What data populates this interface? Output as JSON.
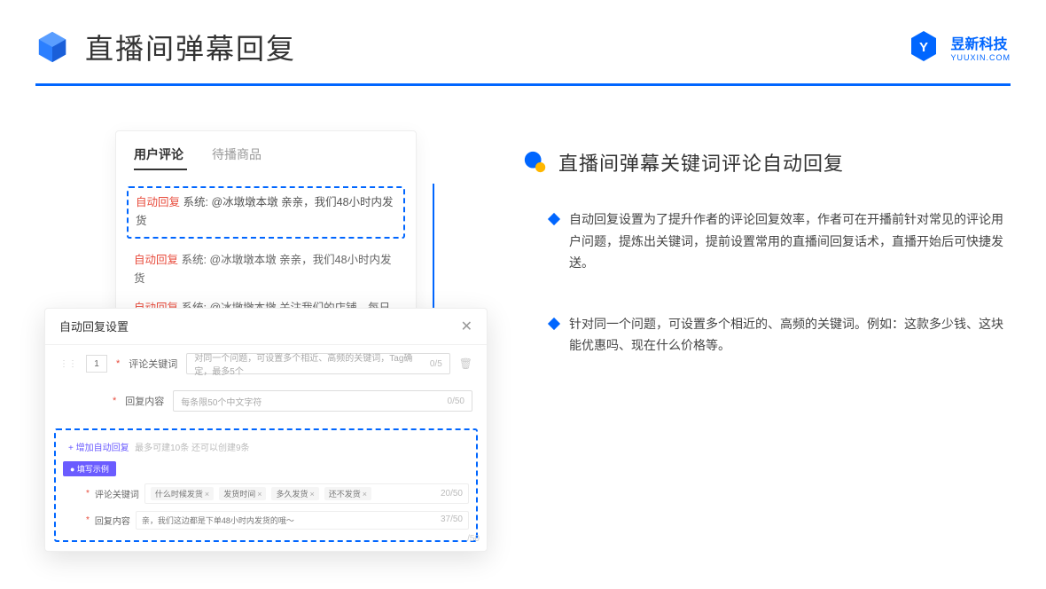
{
  "header": {
    "title": "直播间弹幕回复",
    "brand_cn": "昱新科技",
    "brand_en": "YUUXIN.COM"
  },
  "comments": {
    "tab_active": "用户评论",
    "tab_inactive": "待播商品",
    "tag": "自动回复",
    "sys_prefix": "系统:",
    "row1": "@冰墩墩本墩 亲亲，我们48小时内发货",
    "row2": "@冰墩墩本墩 亲亲，我们48小时内发货",
    "row3": "@冰墩墩本墩 关注我们的店铺，每日都有热门推荐呦～"
  },
  "dialog": {
    "title": "自动回复设置",
    "idx": "1",
    "label_keyword": "评论关键词",
    "placeholder_keyword": "对同一个问题，可设置多个相近、高频的关键词，Tag确定，最多5个",
    "counter_kw": "0/5",
    "label_reply": "回复内容",
    "placeholder_reply": "每条限50个中文字符",
    "counter_reply": "0/50",
    "add_link": "+ 增加自动回复",
    "add_hint": "最多可建10条 还可以创建9条",
    "example_badge": "● 填写示例",
    "ex_label_kw": "评论关键词",
    "chips": [
      "什么时候发货",
      "发货时间",
      "多久发货",
      "还不发货"
    ],
    "ex_counter_kw": "20/50",
    "ex_label_reply": "回复内容",
    "ex_reply_text": "亲，我们这边都是下单48小时内发货的哦～",
    "ex_counter_reply": "37/50",
    "stray_counter": "/50"
  },
  "right_panel": {
    "section_title": "直播间弹幕关键词评论自动回复",
    "bullets": [
      "自动回复设置为了提升作者的评论回复效率，作者可在开播前针对常见的评论用户问题，提炼出关键词，提前设置常用的直播间回复话术，直播开始后可快捷发送。",
      "针对同一个问题，可设置多个相近的、高频的关键词。例如：这款多少钱、这块能优惠吗、现在什么价格等。"
    ]
  }
}
